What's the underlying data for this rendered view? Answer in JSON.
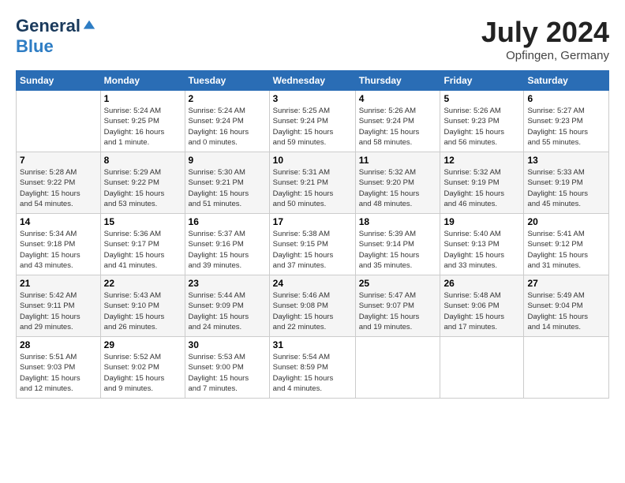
{
  "header": {
    "logo_general": "General",
    "logo_blue": "Blue",
    "month_title": "July 2024",
    "location": "Opfingen, Germany"
  },
  "days_of_week": [
    "Sunday",
    "Monday",
    "Tuesday",
    "Wednesday",
    "Thursday",
    "Friday",
    "Saturday"
  ],
  "weeks": [
    [
      {
        "day": "",
        "info": ""
      },
      {
        "day": "1",
        "info": "Sunrise: 5:24 AM\nSunset: 9:25 PM\nDaylight: 16 hours\nand 1 minute."
      },
      {
        "day": "2",
        "info": "Sunrise: 5:24 AM\nSunset: 9:24 PM\nDaylight: 16 hours\nand 0 minutes."
      },
      {
        "day": "3",
        "info": "Sunrise: 5:25 AM\nSunset: 9:24 PM\nDaylight: 15 hours\nand 59 minutes."
      },
      {
        "day": "4",
        "info": "Sunrise: 5:26 AM\nSunset: 9:24 PM\nDaylight: 15 hours\nand 58 minutes."
      },
      {
        "day": "5",
        "info": "Sunrise: 5:26 AM\nSunset: 9:23 PM\nDaylight: 15 hours\nand 56 minutes."
      },
      {
        "day": "6",
        "info": "Sunrise: 5:27 AM\nSunset: 9:23 PM\nDaylight: 15 hours\nand 55 minutes."
      }
    ],
    [
      {
        "day": "7",
        "info": "Sunrise: 5:28 AM\nSunset: 9:22 PM\nDaylight: 15 hours\nand 54 minutes."
      },
      {
        "day": "8",
        "info": "Sunrise: 5:29 AM\nSunset: 9:22 PM\nDaylight: 15 hours\nand 53 minutes."
      },
      {
        "day": "9",
        "info": "Sunrise: 5:30 AM\nSunset: 9:21 PM\nDaylight: 15 hours\nand 51 minutes."
      },
      {
        "day": "10",
        "info": "Sunrise: 5:31 AM\nSunset: 9:21 PM\nDaylight: 15 hours\nand 50 minutes."
      },
      {
        "day": "11",
        "info": "Sunrise: 5:32 AM\nSunset: 9:20 PM\nDaylight: 15 hours\nand 48 minutes."
      },
      {
        "day": "12",
        "info": "Sunrise: 5:32 AM\nSunset: 9:19 PM\nDaylight: 15 hours\nand 46 minutes."
      },
      {
        "day": "13",
        "info": "Sunrise: 5:33 AM\nSunset: 9:19 PM\nDaylight: 15 hours\nand 45 minutes."
      }
    ],
    [
      {
        "day": "14",
        "info": "Sunrise: 5:34 AM\nSunset: 9:18 PM\nDaylight: 15 hours\nand 43 minutes."
      },
      {
        "day": "15",
        "info": "Sunrise: 5:36 AM\nSunset: 9:17 PM\nDaylight: 15 hours\nand 41 minutes."
      },
      {
        "day": "16",
        "info": "Sunrise: 5:37 AM\nSunset: 9:16 PM\nDaylight: 15 hours\nand 39 minutes."
      },
      {
        "day": "17",
        "info": "Sunrise: 5:38 AM\nSunset: 9:15 PM\nDaylight: 15 hours\nand 37 minutes."
      },
      {
        "day": "18",
        "info": "Sunrise: 5:39 AM\nSunset: 9:14 PM\nDaylight: 15 hours\nand 35 minutes."
      },
      {
        "day": "19",
        "info": "Sunrise: 5:40 AM\nSunset: 9:13 PM\nDaylight: 15 hours\nand 33 minutes."
      },
      {
        "day": "20",
        "info": "Sunrise: 5:41 AM\nSunset: 9:12 PM\nDaylight: 15 hours\nand 31 minutes."
      }
    ],
    [
      {
        "day": "21",
        "info": "Sunrise: 5:42 AM\nSunset: 9:11 PM\nDaylight: 15 hours\nand 29 minutes."
      },
      {
        "day": "22",
        "info": "Sunrise: 5:43 AM\nSunset: 9:10 PM\nDaylight: 15 hours\nand 26 minutes."
      },
      {
        "day": "23",
        "info": "Sunrise: 5:44 AM\nSunset: 9:09 PM\nDaylight: 15 hours\nand 24 minutes."
      },
      {
        "day": "24",
        "info": "Sunrise: 5:46 AM\nSunset: 9:08 PM\nDaylight: 15 hours\nand 22 minutes."
      },
      {
        "day": "25",
        "info": "Sunrise: 5:47 AM\nSunset: 9:07 PM\nDaylight: 15 hours\nand 19 minutes."
      },
      {
        "day": "26",
        "info": "Sunrise: 5:48 AM\nSunset: 9:06 PM\nDaylight: 15 hours\nand 17 minutes."
      },
      {
        "day": "27",
        "info": "Sunrise: 5:49 AM\nSunset: 9:04 PM\nDaylight: 15 hours\nand 14 minutes."
      }
    ],
    [
      {
        "day": "28",
        "info": "Sunrise: 5:51 AM\nSunset: 9:03 PM\nDaylight: 15 hours\nand 12 minutes."
      },
      {
        "day": "29",
        "info": "Sunrise: 5:52 AM\nSunset: 9:02 PM\nDaylight: 15 hours\nand 9 minutes."
      },
      {
        "day": "30",
        "info": "Sunrise: 5:53 AM\nSunset: 9:00 PM\nDaylight: 15 hours\nand 7 minutes."
      },
      {
        "day": "31",
        "info": "Sunrise: 5:54 AM\nSunset: 8:59 PM\nDaylight: 15 hours\nand 4 minutes."
      },
      {
        "day": "",
        "info": ""
      },
      {
        "day": "",
        "info": ""
      },
      {
        "day": "",
        "info": ""
      }
    ]
  ]
}
